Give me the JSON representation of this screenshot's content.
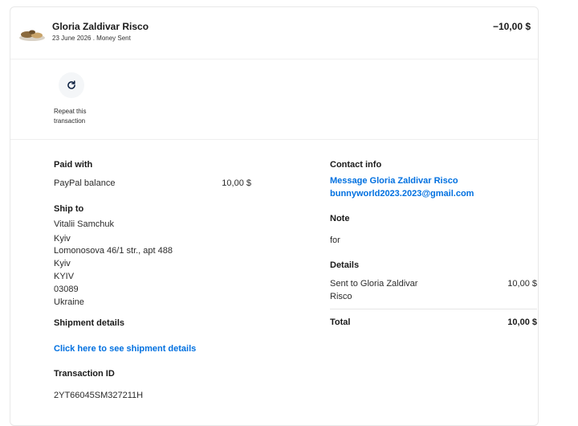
{
  "header": {
    "merchant_name": "Gloria Zaldivar Risco",
    "subline": "23 June 2026 . Money Sent",
    "amount": "−10,00 $"
  },
  "actions": {
    "repeat_label": "Repeat this transaction"
  },
  "paid_with": {
    "title": "Paid with",
    "method": "PayPal balance",
    "amount": "10,00 $"
  },
  "ship_to": {
    "title": "Ship to",
    "lines": [
      "Vitalii Samchuk",
      "Kyiv",
      "Lomonosova 46/1 str., apt 488",
      "Kyiv",
      "KYIV",
      "03089",
      "Ukraine"
    ]
  },
  "shipment": {
    "title": "Shipment details",
    "link": "Click here to see shipment details"
  },
  "transaction": {
    "title": "Transaction ID",
    "id": "2YT66045SM327211H"
  },
  "contact": {
    "title": "Contact info",
    "message_link": "Message Gloria Zaldivar Risco",
    "email": "bunnyworld2023.2023@gmail.com"
  },
  "note": {
    "title": "Note",
    "text": "for"
  },
  "details": {
    "title": "Details",
    "line_label_1": "Sent to Gloria Zaldivar",
    "line_label_2": "Risco",
    "line_amount": "10,00 $",
    "total_label": "Total",
    "total_amount": "10,00 $"
  }
}
